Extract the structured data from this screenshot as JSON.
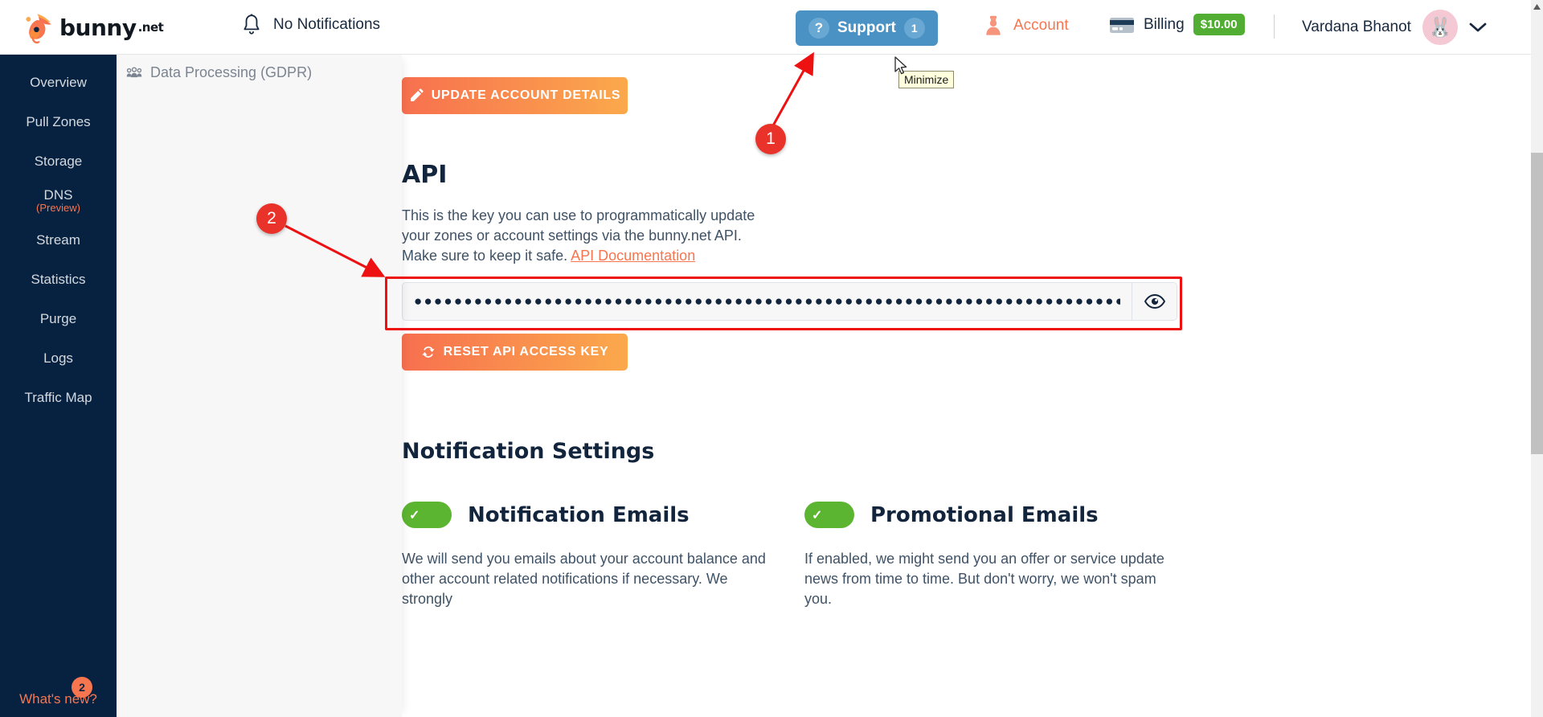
{
  "topbar": {
    "logo_text": "bunny",
    "logo_suffix": ".net",
    "notifications_label": "No Notifications",
    "support_label": "Support",
    "support_icon_glyph": "?",
    "support_count": "1",
    "account_label": "Account",
    "billing_label": "Billing",
    "billing_amount": "$10.00",
    "user_name": "Vardana Bhanot",
    "avatar_glyph": "🐰",
    "caret_glyph": "⌄"
  },
  "sidebar": {
    "items": [
      {
        "label": "Overview",
        "sub": ""
      },
      {
        "label": "Pull Zones",
        "sub": ""
      },
      {
        "label": "Storage",
        "sub": ""
      },
      {
        "label": "DNS",
        "sub": "(Preview)"
      },
      {
        "label": "Stream",
        "sub": ""
      },
      {
        "label": "Statistics",
        "sub": ""
      },
      {
        "label": "Purge",
        "sub": ""
      },
      {
        "label": "Logs",
        "sub": ""
      },
      {
        "label": "Traffic Map",
        "sub": ""
      }
    ],
    "whats_new_label": "What's new?",
    "whats_new_badge": "2"
  },
  "subpanel": {
    "gdpr_label": "Data Processing (GDPR)"
  },
  "main": {
    "update_button_label": "UPDATE ACCOUNT DETAILS",
    "api_heading": "API",
    "api_desc_part1": "This is the key you can use to programmatically update your zones or account settings via the bunny.net API. Make sure to keep it safe. ",
    "api_doc_link": "API Documentation",
    "api_key_value": "●●●●●●●●●●●●●●●●●●●●●●●●●●●●●●●●●●●●●●●●●●●●●●●●●●●●●●●●●●●●●●●●●●●●●●●",
    "reset_button_label": "RESET API ACCESS KEY",
    "notification_settings_heading": "Notification Settings",
    "settings": [
      {
        "title": "Notification Emails",
        "enabled": true,
        "description": "We will send you emails about your account balance and other account related notifications if necessary. We strongly"
      },
      {
        "title": "Promotional Emails",
        "enabled": true,
        "description": "If enabled, we might send you an offer or service update news from time to time. But don't worry, we won't spam you."
      }
    ]
  },
  "annotations": {
    "marker_1": "1",
    "marker_2": "2",
    "tooltip_text": "Minimize"
  },
  "colors": {
    "brand_orange": "#f7764f",
    "sidebar_navy": "#072241",
    "support_blue": "#4a92c4",
    "billing_green": "#52ae32",
    "toggle_green": "#5cb531",
    "annotation_red": "#e8322a"
  }
}
